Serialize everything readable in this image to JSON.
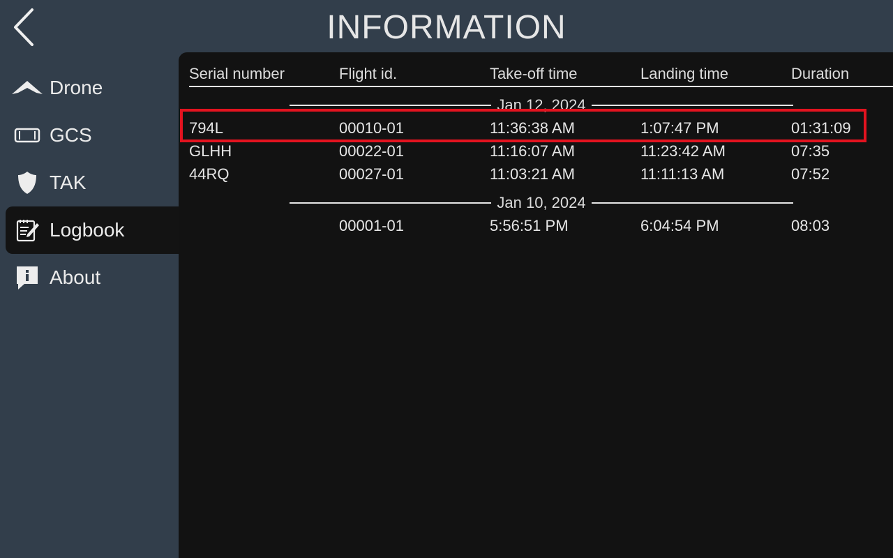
{
  "header": {
    "title": "INFORMATION",
    "back_icon": "chevron-left-icon"
  },
  "sidebar": {
    "items": [
      {
        "label": "Drone",
        "icon": "drone-icon",
        "active": false
      },
      {
        "label": "GCS",
        "icon": "tablet-icon",
        "active": false
      },
      {
        "label": "TAK",
        "icon": "shield-icon",
        "active": false
      },
      {
        "label": "Logbook",
        "icon": "notebook-pen-icon",
        "active": true
      },
      {
        "label": "About",
        "icon": "info-bubble-icon",
        "active": false
      }
    ]
  },
  "logbook": {
    "columns": [
      "Serial number",
      "Flight id.",
      "Take-off time",
      "Landing time",
      "Duration"
    ],
    "groups": [
      {
        "date": "Jan 12, 2024",
        "rows": [
          {
            "serial": "794L",
            "flight_id": "00010-01",
            "takeoff": "11:36:38 AM",
            "landing": "1:07:47 PM",
            "duration": "01:31:09"
          },
          {
            "serial": "GLHH",
            "flight_id": "00022-01",
            "takeoff": "11:16:07 AM",
            "landing": "11:23:42 AM",
            "duration": "07:35"
          },
          {
            "serial": "44RQ",
            "flight_id": "00027-01",
            "takeoff": "11:03:21 AM",
            "landing": "11:11:13 AM",
            "duration": "07:52"
          }
        ]
      },
      {
        "date": "Jan 10, 2024",
        "rows": [
          {
            "serial": "",
            "flight_id": "00001-01",
            "takeoff": "5:56:51 PM",
            "landing": "6:04:54 PM",
            "duration": "08:03"
          }
        ]
      }
    ]
  },
  "colors": {
    "background": "#323e4b",
    "panel": "#121212",
    "text": "#e6e6e6",
    "highlight": "#e3131f"
  }
}
